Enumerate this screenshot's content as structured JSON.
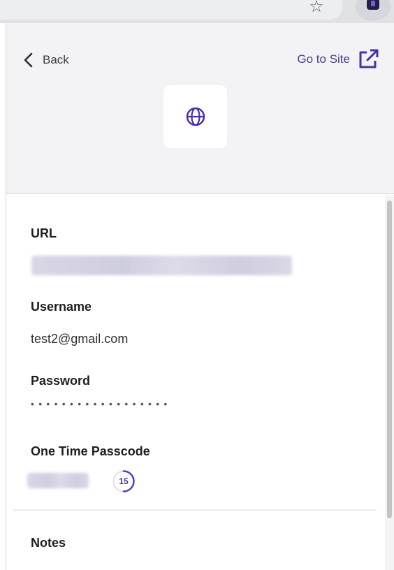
{
  "header": {
    "back_label": "Back",
    "goto_label": "Go to Site",
    "site_icon": "globe-icon"
  },
  "fields": {
    "url_label": "URL",
    "username_label": "Username",
    "username_value": "test2@gmail.com",
    "password_label": "Password",
    "password_mask": "••••••••••••••••••",
    "otp_label": "One Time Passcode",
    "otp_seconds": "15",
    "notes_label": "Notes"
  },
  "colors": {
    "accent": "#5b3fc4",
    "header_bg": "#f3f3f5"
  },
  "icons": {
    "back": "chevron-left-icon",
    "goto": "external-link-icon",
    "star": "star-icon",
    "extension": "extension-icon"
  }
}
